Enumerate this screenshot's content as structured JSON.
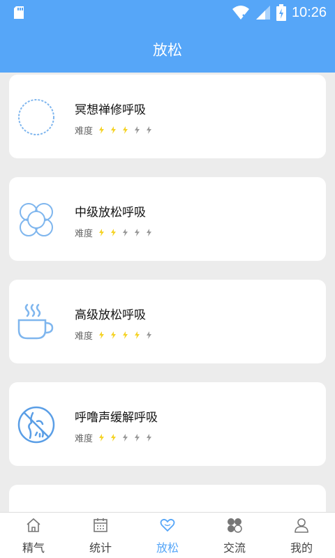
{
  "status_bar": {
    "time": "10:26"
  },
  "header": {
    "title": "放松"
  },
  "difficulty_label": "难度",
  "colors": {
    "accent": "#56a6f8",
    "star_on": "#f5d327",
    "star_off": "#9a9a9a"
  },
  "exercises": [
    {
      "name": "冥想禅修呼吸",
      "icon": "circle-icon",
      "difficulty": 3,
      "max": 5
    },
    {
      "name": "中级放松呼吸",
      "icon": "flower-icon",
      "difficulty": 2,
      "max": 5
    },
    {
      "name": "高级放松呼吸",
      "icon": "teacup-icon",
      "difficulty": 4,
      "max": 5
    },
    {
      "name": "呼噜声缓解呼吸",
      "icon": "snore-face-icon",
      "difficulty": 2,
      "max": 5
    }
  ],
  "tabs": [
    {
      "label": "精气",
      "icon": "home-icon",
      "active": false
    },
    {
      "label": "统计",
      "icon": "calendar-icon",
      "active": false
    },
    {
      "label": "放松",
      "icon": "heart-icon",
      "active": true
    },
    {
      "label": "交流",
      "icon": "community-icon",
      "active": false
    },
    {
      "label": "我的",
      "icon": "person-icon",
      "active": false
    }
  ]
}
